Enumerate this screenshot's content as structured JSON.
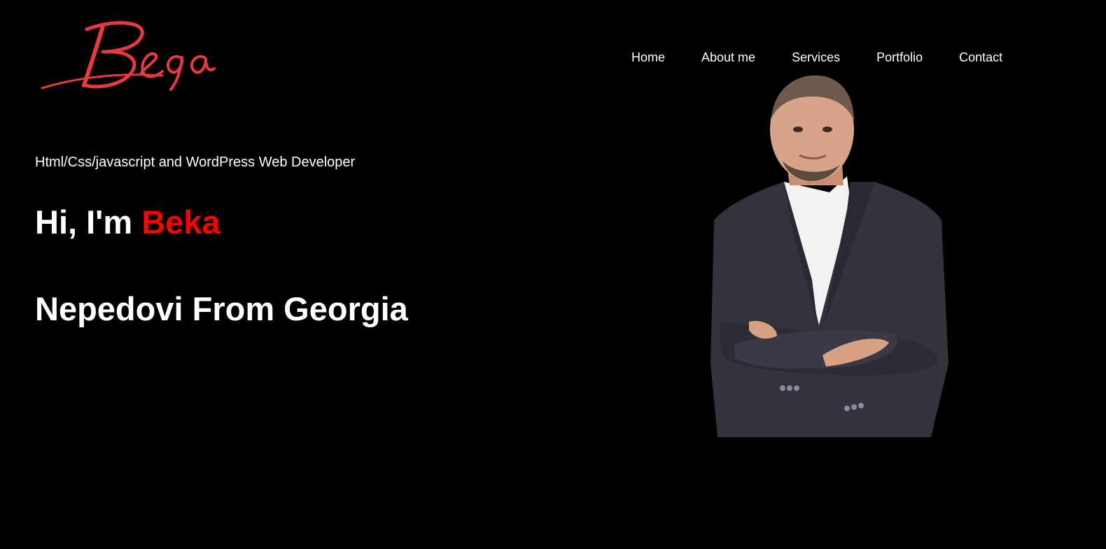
{
  "brand": {
    "logo_text": "Beqa",
    "logo_color": "#e8393f"
  },
  "nav": {
    "items": [
      {
        "label": "Home"
      },
      {
        "label": "About me"
      },
      {
        "label": "Services"
      },
      {
        "label": "Portfolio"
      },
      {
        "label": "Contact"
      }
    ]
  },
  "hero": {
    "tagline": "Html/Css/javascript and WordPress Web Developer",
    "greeting_prefix": "Hi, I'm ",
    "greeting_name": "Beka",
    "subtitle": "Nepedovi From Georgia",
    "accent_color": "#ff0000"
  },
  "portrait": {
    "subject": "man in dark suit with arms crossed"
  }
}
